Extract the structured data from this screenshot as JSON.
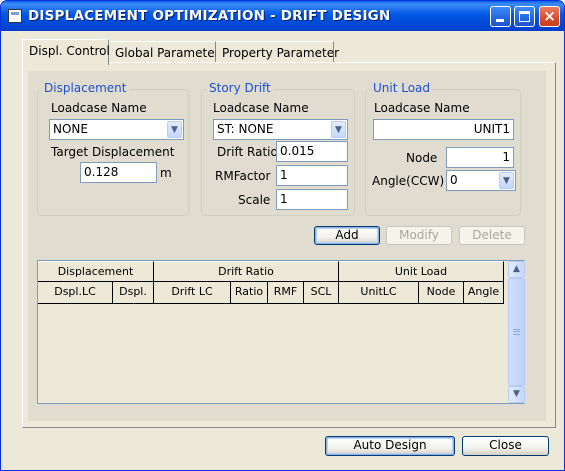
{
  "window": {
    "title": "DISPLACEMENT OPTIMIZATION - DRIFT DESIGN",
    "minimize_glyph": "",
    "maximize_glyph": "",
    "close_glyph": "×"
  },
  "tabs": [
    {
      "label": "Displ. Control",
      "active": true
    },
    {
      "label": "Global Parameter",
      "active": false
    },
    {
      "label": "Property Parameter",
      "active": false
    }
  ],
  "displacement": {
    "group_title": "Displacement",
    "loadcase_label": "Loadcase Name",
    "loadcase_value": "NONE",
    "target_label": "Target Displacement",
    "target_value": "0.128",
    "target_unit": "m"
  },
  "story_drift": {
    "group_title": "Story Drift",
    "loadcase_label": "Loadcase Name",
    "loadcase_value": "ST: NONE",
    "drift_ratio_label": "Drift Ratio",
    "drift_ratio_value": "0.015",
    "rmfactor_label": "RMFactor",
    "rmfactor_value": "1",
    "scale_label": "Scale",
    "scale_value": "1"
  },
  "unit_load": {
    "group_title": "Unit Load",
    "loadcase_label": "Loadcase Name",
    "loadcase_value": "UNIT1",
    "node_label": "Node",
    "node_value": "1",
    "angle_label": "Angle(CCW)",
    "angle_value": "0"
  },
  "actions": {
    "add": "Add",
    "modify": "Modify",
    "delete": "Delete"
  },
  "table": {
    "group_headers": [
      "Displacement",
      "Drift Ratio",
      "Unit Load"
    ],
    "columns": [
      "Dspl.LC",
      "Dspl.",
      "Drift LC",
      "Ratio",
      "RMF",
      "SCL",
      "UnitLC",
      "Node",
      "Angle"
    ],
    "rows": []
  },
  "footer": {
    "auto_design": "Auto Design",
    "close": "Close"
  },
  "colors": {
    "titlebar": "#0054E3",
    "window_bg": "#ECE9D8",
    "group_title": "#1F4FCF"
  }
}
